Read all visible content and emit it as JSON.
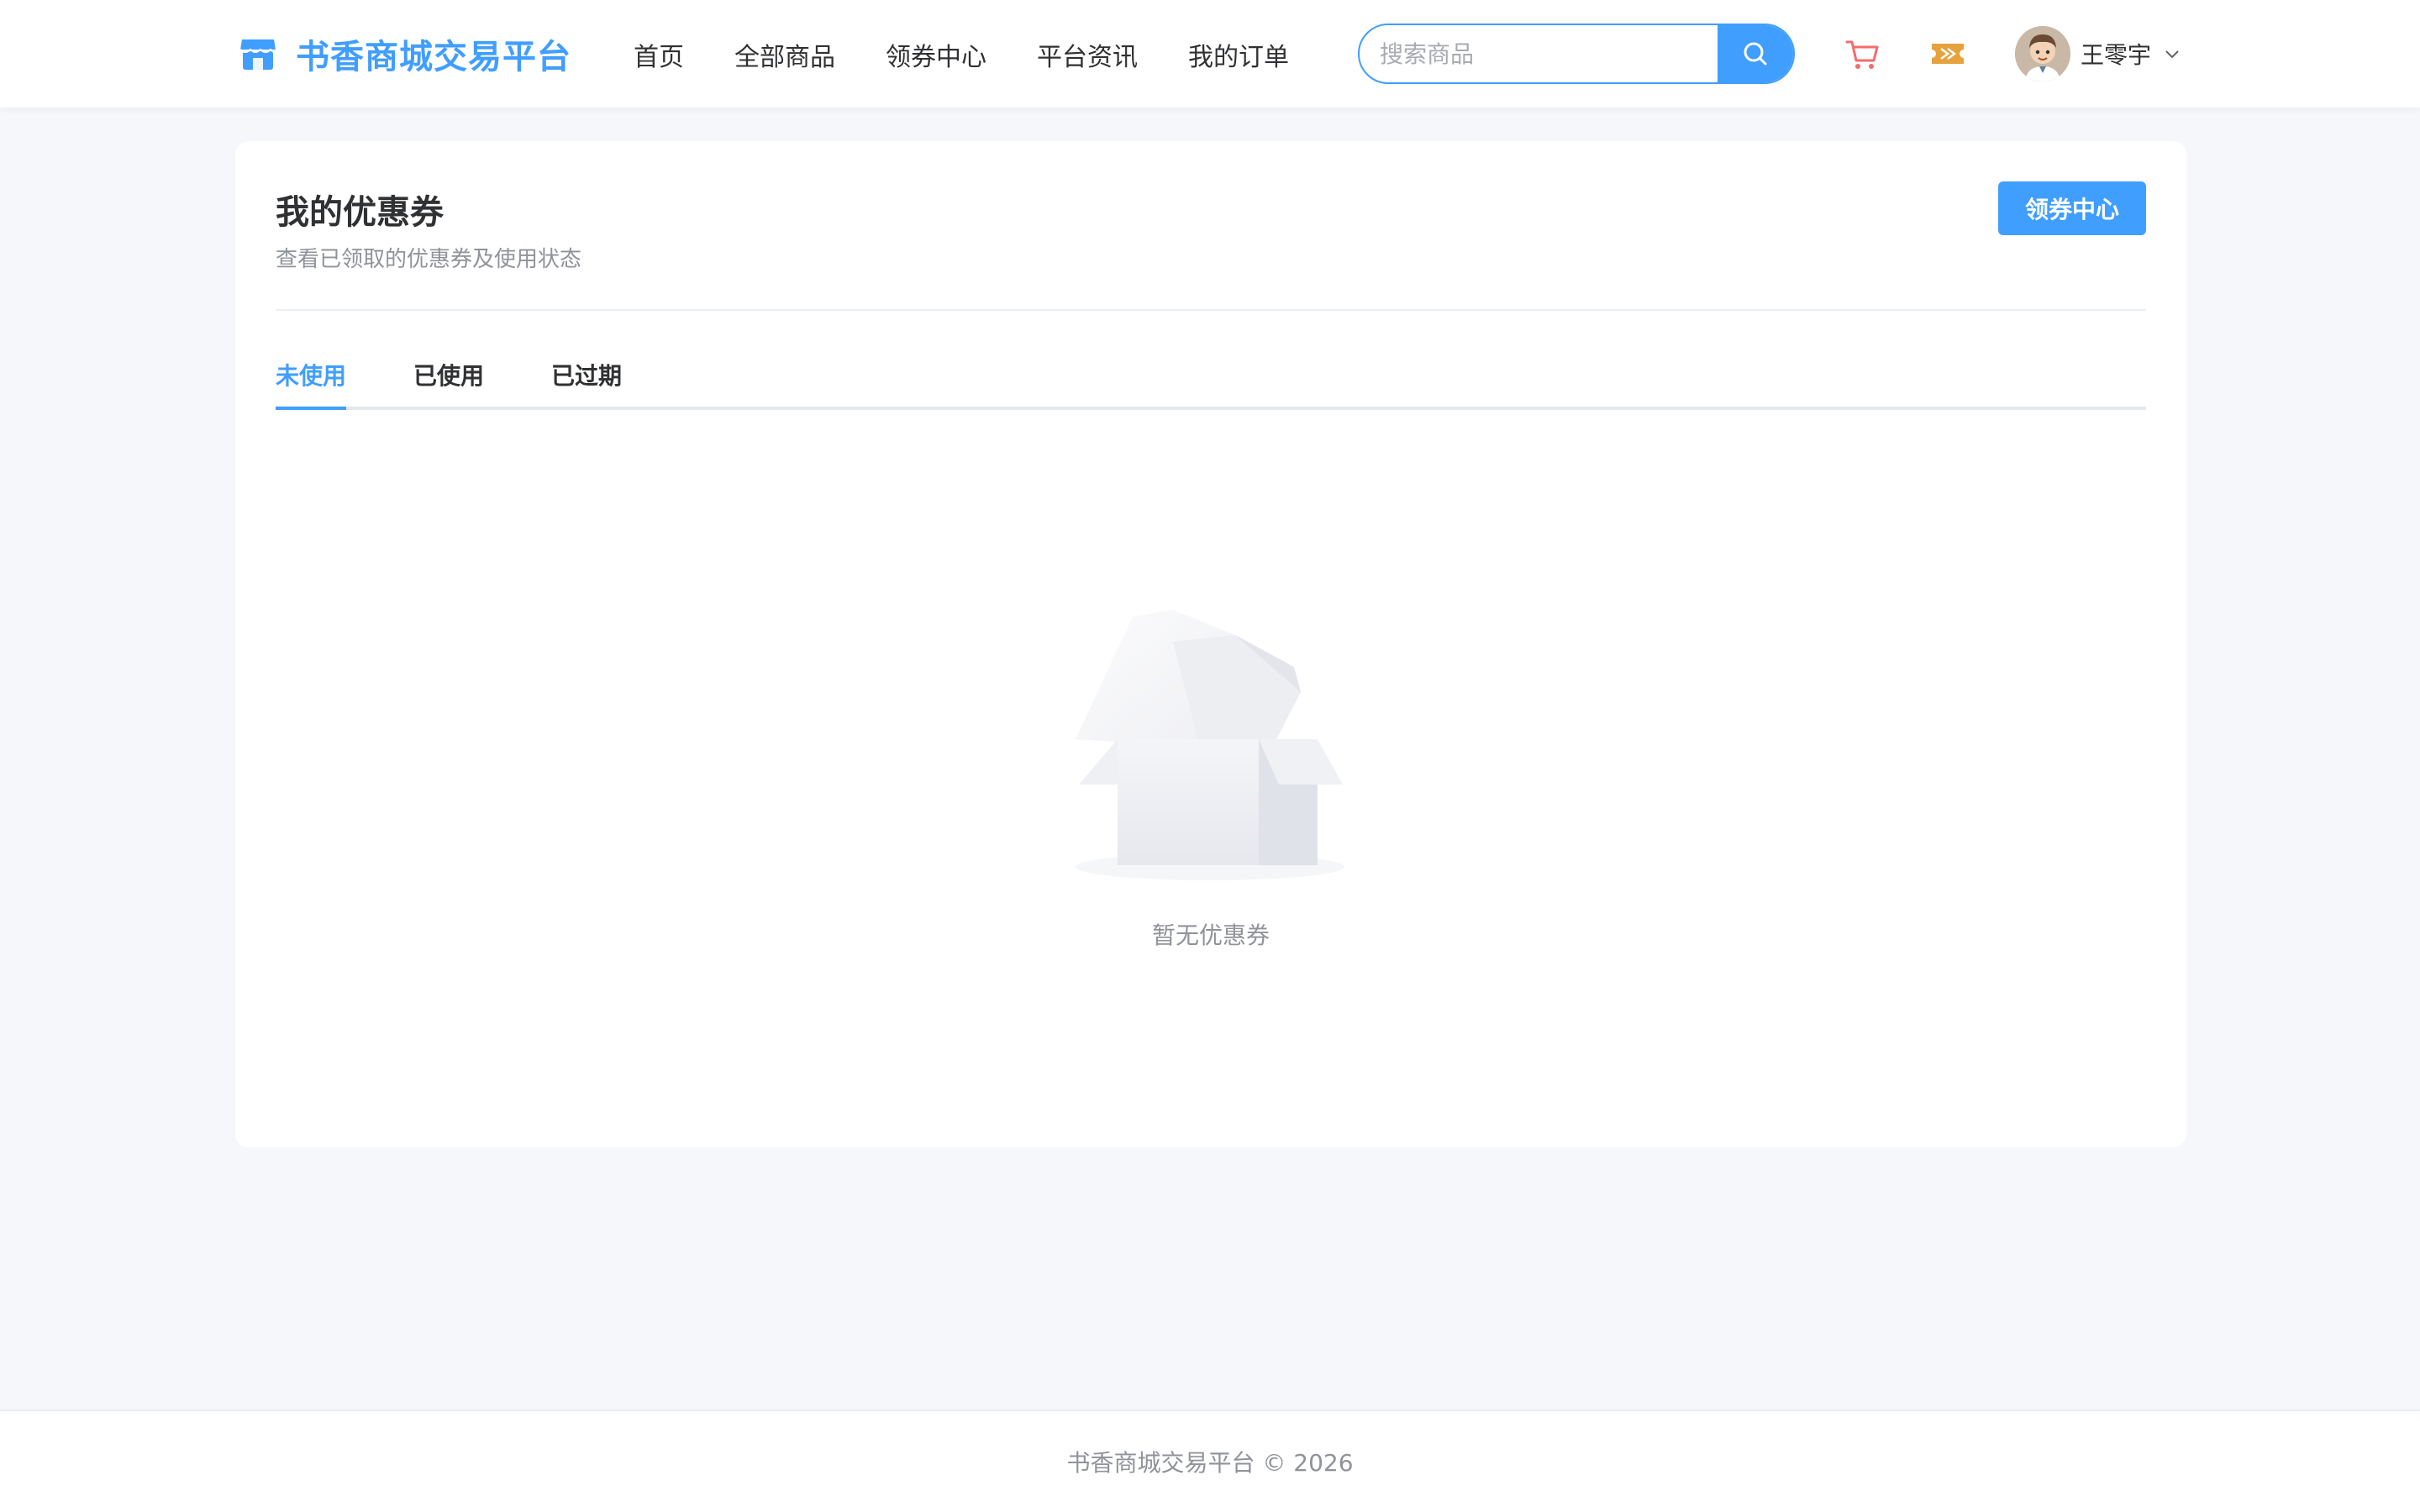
{
  "header": {
    "brand": "书香商城交易平台",
    "nav": [
      "首页",
      "全部商品",
      "领券中心",
      "平台资讯",
      "我的订单"
    ],
    "search": {
      "placeholder": "搜索商品",
      "value": ""
    },
    "icons": [
      "cart-icon",
      "coupon-icon",
      "search-icon"
    ],
    "user": {
      "name": "王零宇"
    }
  },
  "page": {
    "title": "我的优惠券",
    "subtitle": "查看已领取的优惠券及使用状态",
    "action_button": "领券中心",
    "tabs": [
      {
        "label": "未使用",
        "active": true
      },
      {
        "label": "已使用",
        "active": false
      },
      {
        "label": "已过期",
        "active": false
      }
    ],
    "empty_text": "暂无优惠券"
  },
  "footer": {
    "copyright": "书香商城交易平台 © 2026"
  },
  "colors": {
    "accent": "#409eff",
    "cart": "#f56c6c",
    "coupon": "#e6a23c",
    "background": "#f5f7fa"
  }
}
